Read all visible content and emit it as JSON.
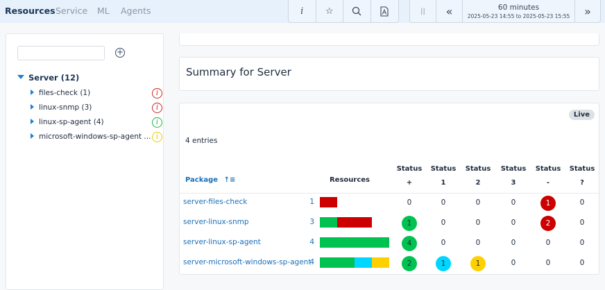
{
  "nav": {
    "tabs": [
      {
        "label": "Resources",
        "active": true
      },
      {
        "label": "Service"
      },
      {
        "label": "ML"
      },
      {
        "label": "Agents"
      }
    ]
  },
  "toolbar": {
    "buttons": [
      "info-icon",
      "star-icon",
      "search-icon",
      "pdf-icon"
    ],
    "info_label": "i"
  },
  "timerange": {
    "duration": "60 minutes",
    "range": "2025-05-23 14:55 to 2025-05-23 15:55",
    "icons": [
      "pause-icon",
      "rewind-icon",
      "forward-icon"
    ]
  },
  "sidebar": {
    "search_placeholder": "",
    "root": "Server (12)",
    "items": [
      {
        "label": "files-check (1)",
        "status": "red"
      },
      {
        "label": "linux-snmp (3)",
        "status": "red"
      },
      {
        "label": "linux-sp-agent (4)",
        "status": "green"
      },
      {
        "label": "microsoft-windows-sp-agent ...",
        "status": "yellow"
      }
    ]
  },
  "summary": {
    "title": "Summary for Server"
  },
  "table": {
    "live": "Live",
    "entries": "4 entries",
    "headers": {
      "package": "Package",
      "resources": "Resources",
      "status": [
        [
          "Status",
          "+"
        ],
        [
          "Status",
          "1"
        ],
        [
          "Status",
          "2"
        ],
        [
          "Status",
          "3"
        ],
        [
          "Status",
          "-"
        ],
        [
          "Status",
          "?"
        ]
      ]
    },
    "rows": [
      {
        "package": "server-files-check",
        "count": "1",
        "status": [
          "0",
          "0",
          "0",
          "0",
          "1",
          "0"
        ]
      },
      {
        "package": "server-linux-snmp",
        "count": "3",
        "status": [
          "1",
          "0",
          "0",
          "0",
          "2",
          "0"
        ]
      },
      {
        "package": "server-linux-sp-agent",
        "count": "4",
        "status": [
          "4",
          "0",
          "0",
          "0",
          "0",
          "0"
        ]
      },
      {
        "package": "server-microsoft-windows-sp-agent",
        "count": "4",
        "status": [
          "2",
          "1",
          "1",
          "0",
          "0",
          "0"
        ]
      }
    ]
  },
  "colors": {
    "status": [
      "#00c250",
      "#00d6ff",
      "#ffd000",
      "#888888",
      "#cc0000",
      "#888888"
    ],
    "red": "#cc0000",
    "green": "#00c250",
    "yellow": "#ffd000",
    "accent": "#1a6fb8"
  }
}
